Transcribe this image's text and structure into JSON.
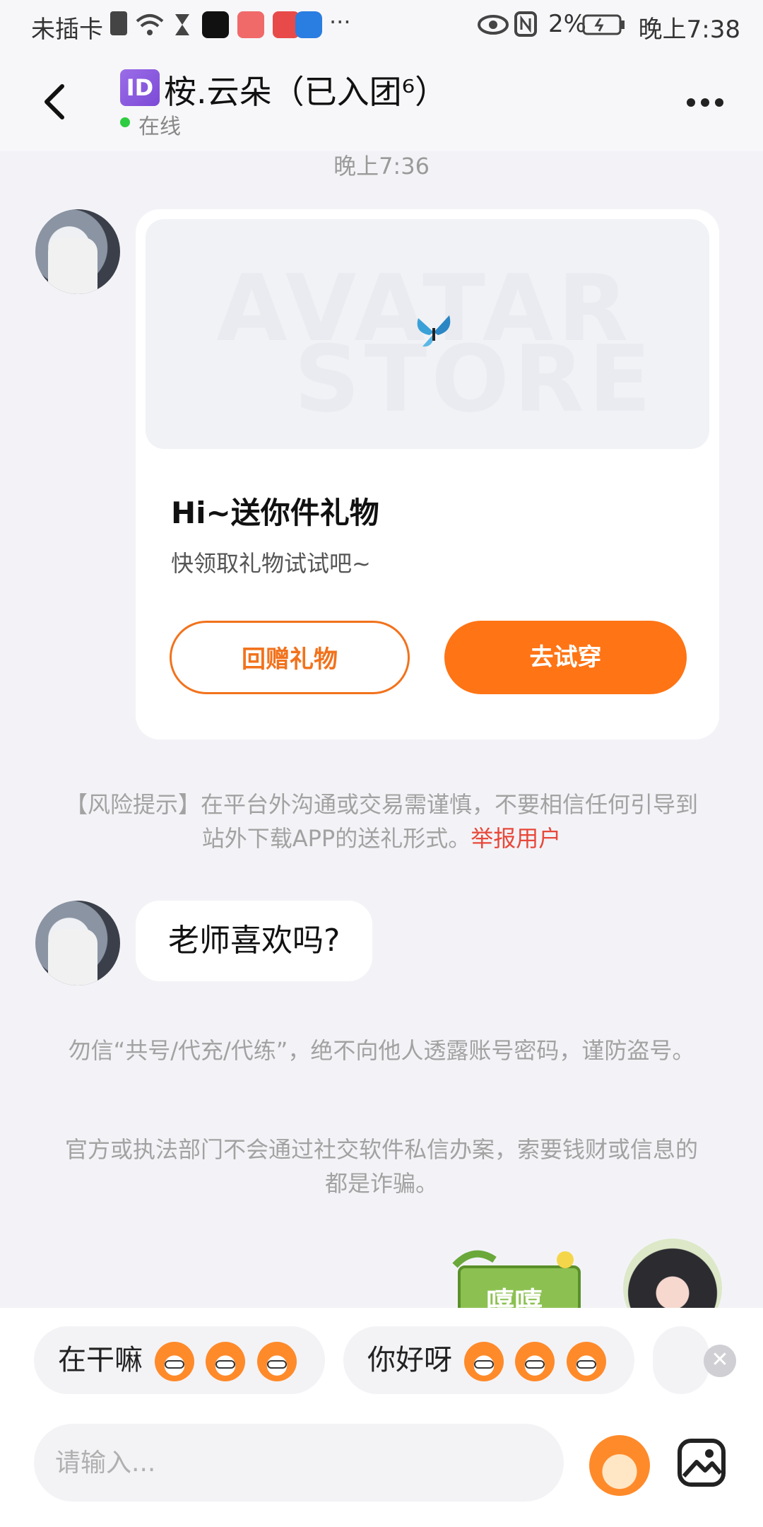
{
  "status_bar": {
    "carrier": "未插卡",
    "battery": "2%",
    "time": "晚上7:38",
    "icons": [
      "sim-icon",
      "wifi-icon",
      "hourglass-icon",
      "tiktok-icon",
      "app-icon",
      "app-icon",
      "bulb-icon",
      "more-icon",
      "eye-icon",
      "nfc-icon",
      "battery-icon"
    ],
    "more": "···"
  },
  "header": {
    "id_badge": "ID",
    "title": "桉.云朵（已入团⁶）",
    "status": "在线"
  },
  "messages": {
    "time": "晚上7:36",
    "gift_card": {
      "watermark_line1": "AVATAR",
      "watermark_line2": "STORE",
      "title": "Hi~送你件礼物",
      "subtitle": "快领取礼物试试吧~",
      "btn_return_gift": "回赠礼物",
      "btn_try_on": "去试穿"
    },
    "risk_notice": "【风险提示】在平台外沟通或交易需谨慎，不要相信任何引导到站外下载APP的送礼形式。",
    "report_user": "举报用户",
    "bubble_text": "老师喜欢吗?",
    "notice_1": "勿信“共号/代充/代练”，绝不向他人透露账号密码，谨防盗号。",
    "notice_2": "官方或执法部门不会通过社交软件私信办案，索要钱财或信息的都是诈骗。",
    "sticker_text": "嘻嘻"
  },
  "quick_replies": [
    {
      "text": "在干嘛"
    },
    {
      "text": "你好呀"
    }
  ],
  "input": {
    "placeholder": "请输入..."
  },
  "colors": {
    "accent": "#ff7414",
    "report": "#e8483a",
    "online": "#2ecc40"
  }
}
